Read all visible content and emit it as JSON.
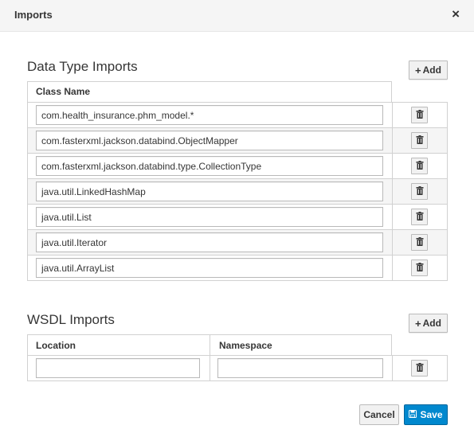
{
  "dialog": {
    "title": "Imports",
    "close_label": "×"
  },
  "data_type_imports": {
    "title": "Data Type Imports",
    "add_label": "Add",
    "column_class_name": "Class Name",
    "rows": [
      "com.health_insurance.phm_model.*",
      "com.fasterxml.jackson.databind.ObjectMapper",
      "com.fasterxml.jackson.databind.type.CollectionType",
      "java.util.LinkedHashMap",
      "java.util.List",
      "java.util.Iterator",
      "java.util.ArrayList"
    ]
  },
  "wsdl_imports": {
    "title": "WSDL Imports",
    "add_label": "Add",
    "column_location": "Location",
    "column_namespace": "Namespace",
    "rows": [
      {
        "location": "",
        "namespace": ""
      }
    ]
  },
  "footer": {
    "cancel_label": "Cancel",
    "save_label": "Save"
  },
  "colors": {
    "primary": "#0088ce",
    "header_bg": "#f5f5f5"
  },
  "icons": {
    "delete": "trash-icon",
    "add": "plus-icon",
    "save": "floppy-disk-icon",
    "close": "close-icon"
  }
}
